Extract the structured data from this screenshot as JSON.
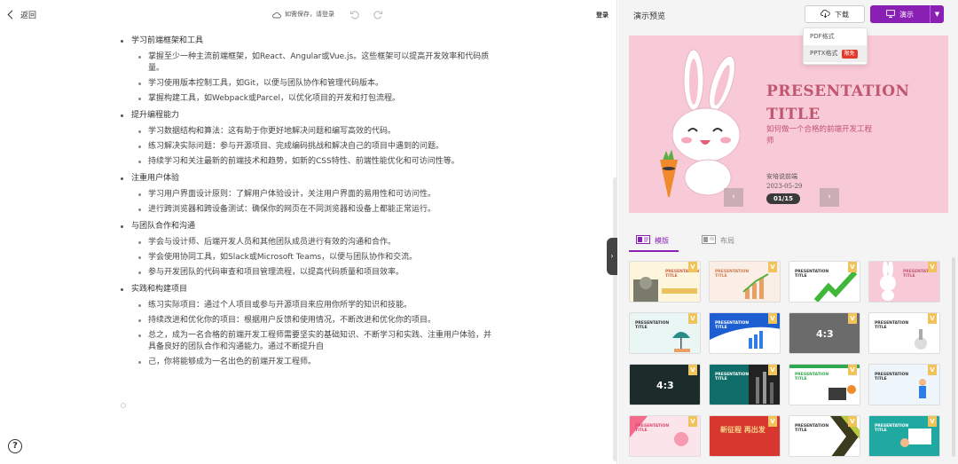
{
  "editor": {
    "back_label": "返回",
    "save_status": "如需保存，请登录",
    "login_label": "登录",
    "help_label": "?",
    "outline": [
      {
        "title": "学习前端框架和工具",
        "items": [
          "掌握至少一种主流前端框架，如React、Angular或Vue.js。这些框架可以提高开发效率和代码质量。",
          "学习使用版本控制工具，如Git，以便与团队协作和管理代码版本。",
          "掌握构建工具，如Webpack或Parcel，以优化项目的开发和打包流程。"
        ]
      },
      {
        "title": "提升编程能力",
        "items": [
          "学习数据结构和算法：这有助于你更好地解决问题和编写高效的代码。",
          "练习解决实际问题：参与开源项目、完成编码挑战和解决自己的项目中遇到的问题。",
          "持续学习和关注最新的前端技术和趋势，如新的CSS特性、前端性能优化和可访问性等。"
        ]
      },
      {
        "title": "注重用户体验",
        "items": [
          "学习用户界面设计原则：了解用户体验设计，关注用户界面的易用性和可访问性。",
          "进行跨浏览器和跨设备测试：确保你的网页在不同浏览器和设备上都能正常运行。"
        ]
      },
      {
        "title": "与团队合作和沟通",
        "items": [
          "学会与设计师、后端开发人员和其他团队成员进行有效的沟通和合作。",
          "学会使用协同工具，如Slack或Microsoft Teams，以便与团队协作和交流。",
          "参与开发团队的代码审查和项目管理流程，以提高代码质量和项目效率。"
        ]
      },
      {
        "title": "实践和构建项目",
        "items": [
          "练习实际项目：通过个人项目或参与开源项目来应用你所学的知识和技能。",
          "持续改进和优化你的项目：根据用户反馈和使用情况，不断改进和优化你的项目。",
          "总之，成为一名合格的前端开发工程师需要坚实的基础知识、不断学习和实践、注重用户体验，并具备良好的团队合作和沟通能力。通过不断提升自",
          "己，你将能够成为一名出色的前端开发工程师。"
        ]
      }
    ]
  },
  "preview": {
    "title": "演示预览",
    "download_label": "下载",
    "present_label": "演示",
    "dropdown": {
      "items": [
        "PDF格式",
        "PPTX格式"
      ],
      "vip_badge": "限免"
    },
    "slide": {
      "title_line1": "PRESENTATION",
      "title_line2": "TITLE",
      "subtitle": "如何做一个合格的前端开发工程师",
      "author": "安培说前端",
      "date": "2023-05-29",
      "page_indicator": "01/15"
    },
    "tabs": {
      "template": "模版",
      "layout": "布局"
    },
    "thumb_title": "PRESENTATION TITLE",
    "thumb_ratio": "4:3",
    "thumb_cn_title": "新征程 再出发",
    "vip_mark": "V",
    "colors": {
      "accent": "#8a1fb4",
      "slide_bg": "#f8c9d6",
      "slide_text": "#c0566f",
      "vip_red": "#e43a2a"
    }
  }
}
